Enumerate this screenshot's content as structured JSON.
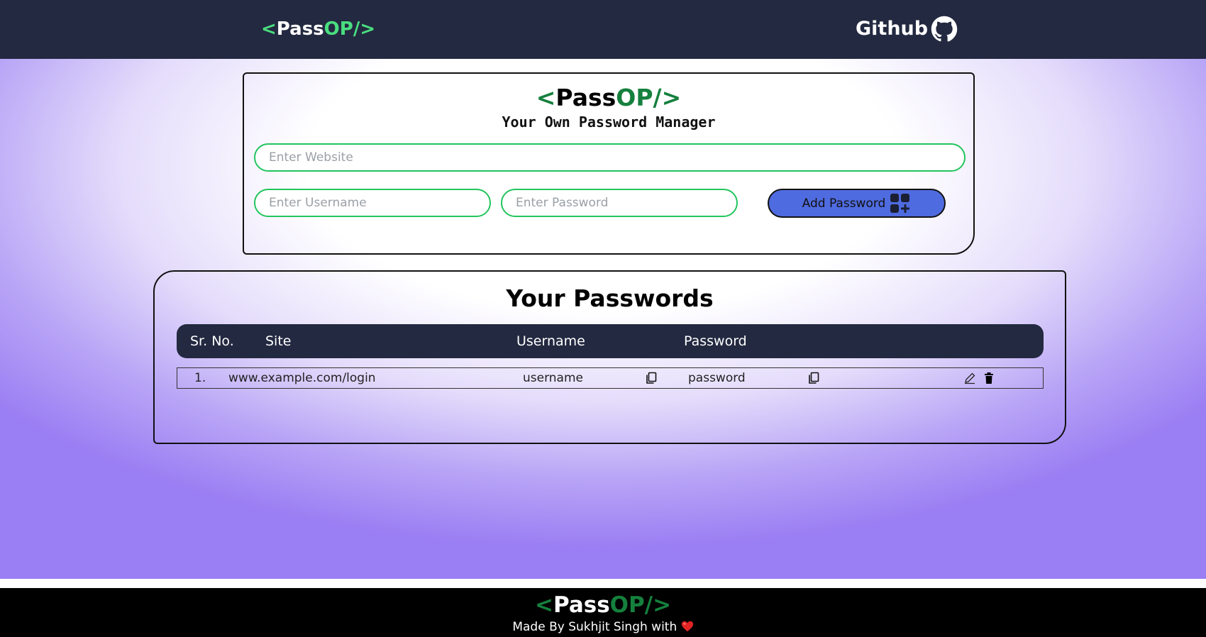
{
  "nav": {
    "logo": {
      "open": "<",
      "pass": "Pass",
      "op": "OP/",
      "close": ">"
    },
    "github_label": "Github",
    "github_icon": "github-icon"
  },
  "form": {
    "logo": {
      "open": "<",
      "pass": "Pass",
      "op": "OP/",
      "close": ">"
    },
    "subtitle": "Your Own Password Manager",
    "website_placeholder": "Enter Website",
    "username_placeholder": "Enter Username",
    "password_placeholder": "Enter Password",
    "add_button_label": "Add Password",
    "add_button_icon": "add-grid-icon"
  },
  "passwords": {
    "title": "Your Passwords",
    "columns": [
      "Sr. No.",
      "Site",
      "Username",
      "Password"
    ],
    "rows": [
      {
        "sr": "1.",
        "site": "www.example.com/login",
        "username": "username",
        "password": "password"
      }
    ]
  },
  "footer": {
    "logo": {
      "open": "<",
      "pass": "Pass",
      "op": "OP/",
      "close": ">"
    },
    "text": "Made By Sukhjit Singh with",
    "heart_icon": "heart-icon"
  },
  "colors": {
    "nav_bg": "#232940",
    "accent_green": "#4ade80",
    "dark_green": "#15803d",
    "button_blue": "#4f6be0",
    "input_border": "#22c55e"
  }
}
